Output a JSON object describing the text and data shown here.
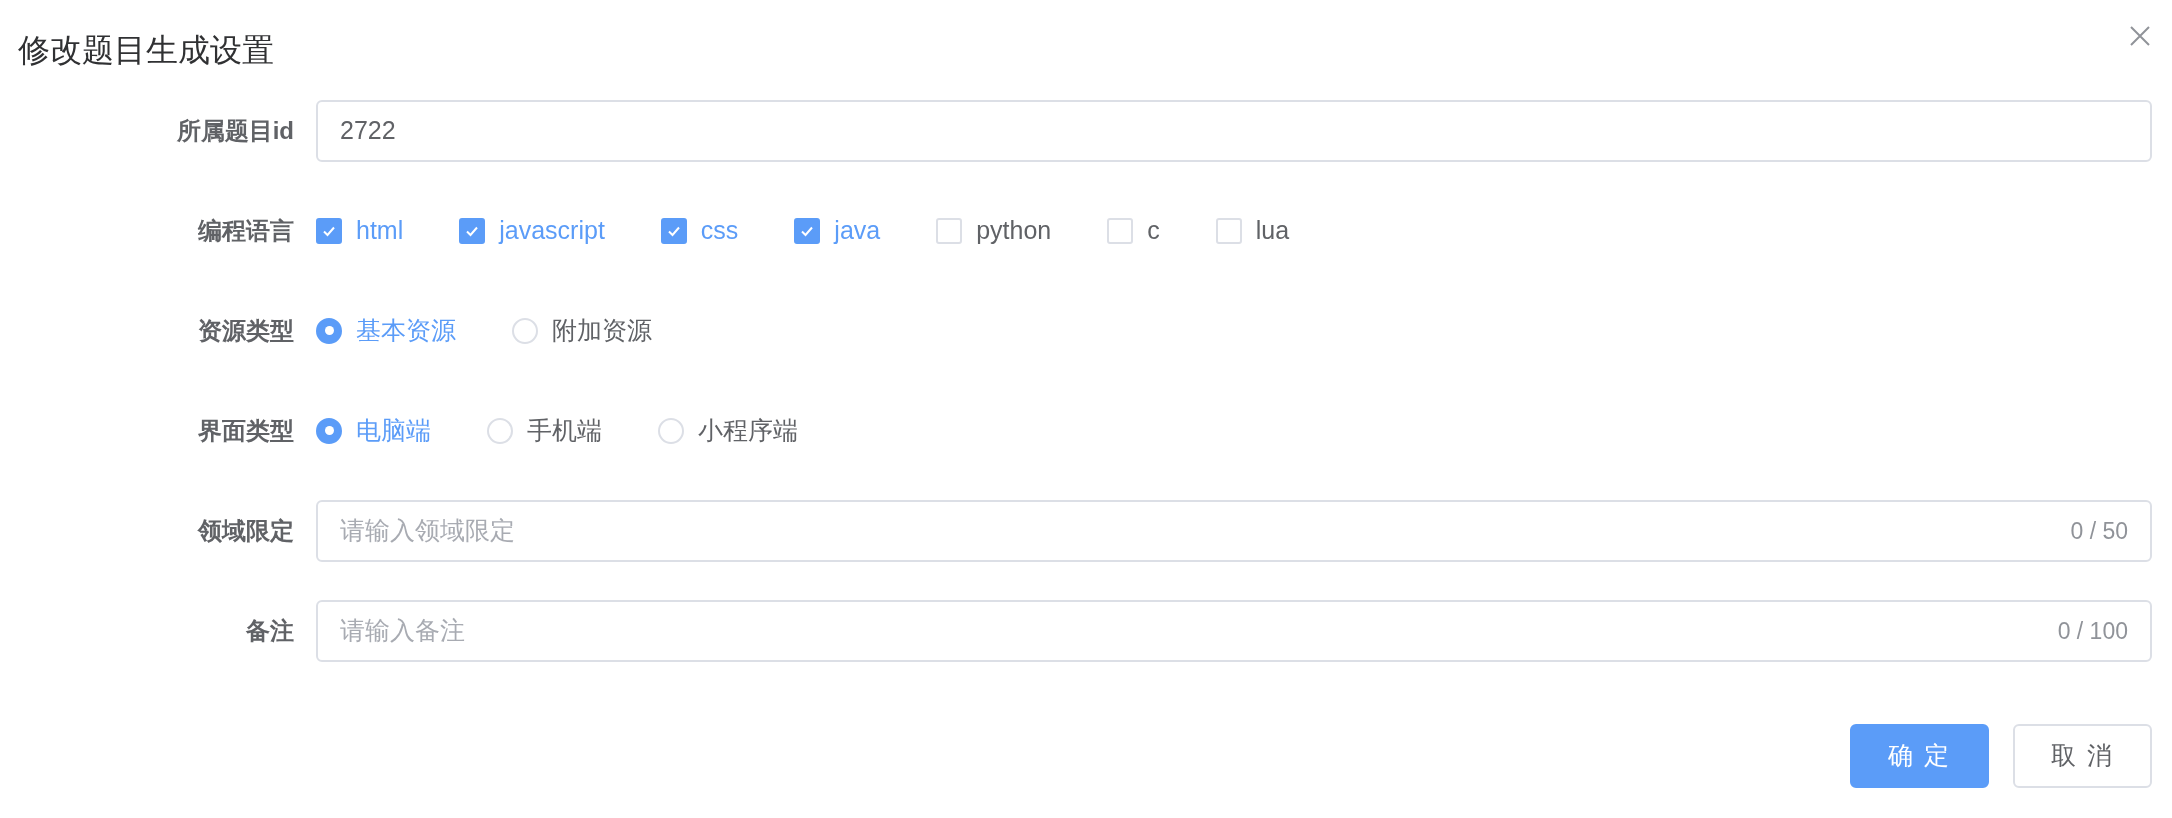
{
  "dialog": {
    "title": "修改题目生成设置"
  },
  "fields": [
    {
      "kind": "text",
      "label": "所属题目id",
      "value": "2722"
    },
    {
      "kind": "checkbox",
      "label": "编程语言",
      "options": [
        {
          "label": "html",
          "checked": true
        },
        {
          "label": "javascript",
          "checked": true
        },
        {
          "label": "css",
          "checked": true
        },
        {
          "label": "java",
          "checked": true
        },
        {
          "label": "python",
          "checked": false
        },
        {
          "label": "c",
          "checked": false
        },
        {
          "label": "lua",
          "checked": false
        }
      ]
    },
    {
      "kind": "radio",
      "label": "资源类型",
      "options": [
        {
          "label": "基本资源",
          "selected": true
        },
        {
          "label": "附加资源",
          "selected": false
        }
      ]
    },
    {
      "kind": "radio",
      "label": "界面类型",
      "options": [
        {
          "label": "电脑端",
          "selected": true
        },
        {
          "label": "手机端",
          "selected": false
        },
        {
          "label": "小程序端",
          "selected": false
        }
      ]
    },
    {
      "kind": "text",
      "label": "领域限定",
      "placeholder": "请输入领域限定",
      "counter": "0 / 50"
    },
    {
      "kind": "text",
      "label": "备注",
      "placeholder": "请输入备注",
      "counter": "0 / 100"
    }
  ],
  "buttons": [
    {
      "label": "确 定",
      "kind": "primary"
    },
    {
      "label": "取 消",
      "kind": "default"
    }
  ]
}
